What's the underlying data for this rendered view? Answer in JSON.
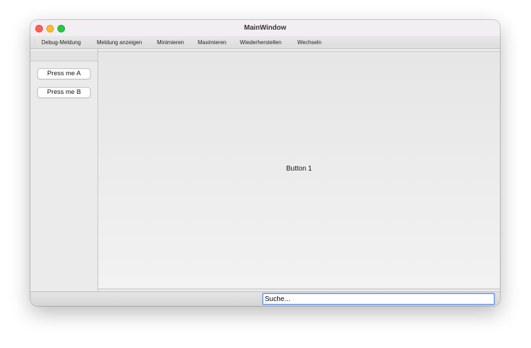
{
  "window": {
    "title": "MainWindow"
  },
  "toolbar": {
    "items": [
      "Debug-Meldung",
      "Meldung anzeigen",
      "Minimieren",
      "Maximieren",
      "Wiederherstellen",
      "Wechseln"
    ]
  },
  "sidebar": {
    "button_a": "Press me A",
    "button_b": "Press me B"
  },
  "content": {
    "label": "Button 1"
  },
  "statusbar": {
    "search_value": "Suche..."
  },
  "colors": {
    "close": "#fe5f57",
    "minimize": "#febc2e",
    "maximize": "#28c840",
    "focus_ring": "#86a9e3"
  },
  "icons": [
    "close-icon",
    "minimize-icon",
    "maximize-icon",
    "toolbar-grip-icon"
  ]
}
